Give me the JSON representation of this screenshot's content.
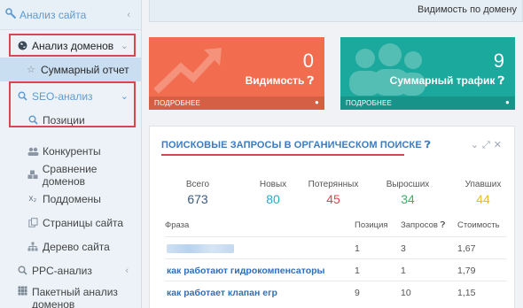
{
  "sidebar": {
    "top_label": "Анализ сайта",
    "items": [
      {
        "label": "Анализ доменов"
      },
      {
        "label": "Суммарный отчет"
      },
      {
        "label": "SEO-анализ"
      },
      {
        "label": "Позиции"
      },
      {
        "label": "Конкуренты"
      },
      {
        "label": "Сравнение доменов"
      },
      {
        "label": "Поддомены"
      },
      {
        "label": "Страницы сайта"
      },
      {
        "label": "Дерево сайта"
      },
      {
        "label": "PPC-анализ"
      },
      {
        "label": "Пакетный анализ доменов"
      }
    ],
    "subdomain_icon_text": "x₂"
  },
  "topbar": {
    "text": "Видимость по домену"
  },
  "cards": [
    {
      "value": "0",
      "label": "Видимость",
      "footer": "ПОДРОБНЕЕ",
      "color": "#f26d4f"
    },
    {
      "value": "9",
      "label": "Суммарный трафик",
      "footer": "ПОДРОБНЕЕ",
      "color": "#1ba89d"
    }
  ],
  "panel": {
    "title": "ПОИСКОВЫЕ ЗАПРОСЫ В ОРГАНИЧЕСКОМ ПОИСКЕ",
    "stats": [
      {
        "label": "Всего",
        "value": "673",
        "color": "#3b5a7a"
      },
      {
        "label": "Новых",
        "value": "80",
        "color": "#29a9c9"
      },
      {
        "label": "Потерянных",
        "value": "45",
        "color": "#d9464b"
      },
      {
        "label": "Выросших",
        "value": "34",
        "color": "#2fb56a"
      },
      {
        "label": "Упавших",
        "value": "44",
        "color": "#f0b72f"
      }
    ],
    "columns": [
      "Фраза",
      "Позиция",
      "Запросов",
      "Стоимость"
    ],
    "rows": [
      {
        "phrase": "",
        "position": "1",
        "queries": "3",
        "cost": "1,67"
      },
      {
        "phrase": "как работают гидрокомпенсаторы",
        "position": "1",
        "queries": "1",
        "cost": "1,79"
      },
      {
        "phrase": "как работает клапан егр",
        "position": "9",
        "queries": "10",
        "cost": "1,15"
      }
    ]
  }
}
